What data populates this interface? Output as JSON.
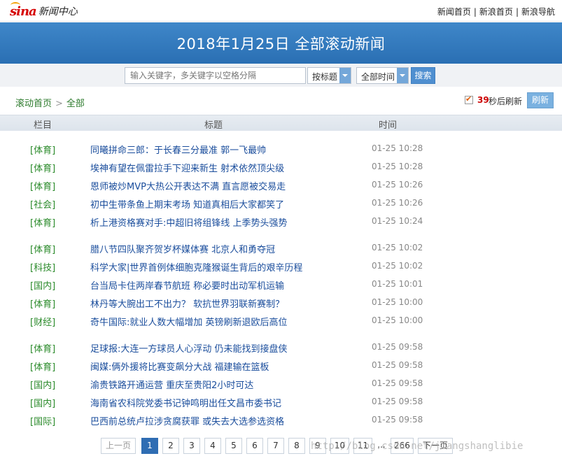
{
  "topbar": {
    "logo_mark": "sina",
    "logo_text": "新闻中心",
    "links": [
      "新闻首页",
      "新浪首页",
      "新浪导航"
    ],
    "separator": "|"
  },
  "banner": {
    "title": "2018年1月25日 全部滚动新闻"
  },
  "search": {
    "placeholder": "输入关键字，多关键字以空格分隔",
    "type_select": "按标题",
    "time_select": "全部时间",
    "button": "搜索"
  },
  "breadcrumb": {
    "home": "滚动首页",
    "sep": ">",
    "current": "全部"
  },
  "refresh": {
    "checked": true,
    "seconds": "39",
    "text": "秒后刷新",
    "button": "刷新"
  },
  "columns": {
    "category": "栏目",
    "title": "标题",
    "time": "时间"
  },
  "news_groups": [
    [
      {
        "cat": "[体育]",
        "title": "同曦拼命三郎：于长春三分最准 郭一飞最帅",
        "time": "01-25 10:28"
      },
      {
        "cat": "[体育]",
        "title": "埃神有望在佩雷拉手下迎来新生 射术依然顶尖级",
        "time": "01-25 10:28"
      },
      {
        "cat": "[体育]",
        "title": "恩师被炒MVP大热公开表达不满 直言愿被交易走",
        "time": "01-25 10:26"
      },
      {
        "cat": "[社会]",
        "title": "初中生带条鱼上期末考场 知道真相后大家都笑了",
        "time": "01-25 10:26"
      },
      {
        "cat": "[体育]",
        "title": "析上港资格赛对手:中超旧将组锋线 上季势头强势",
        "time": "01-25 10:24"
      }
    ],
    [
      {
        "cat": "[体育]",
        "title": "腊八节四队聚齐贺岁杯媒体赛 北京人和勇夺冠",
        "time": "01-25 10:02"
      },
      {
        "cat": "[科技]",
        "title": "科学大家|世界首例体细胞克隆猴诞生背后的艰辛历程",
        "time": "01-25 10:02"
      },
      {
        "cat": "[国内]",
        "title": "台当局卡住两岸春节航班 称必要时出动军机运输",
        "time": "01-25 10:01"
      },
      {
        "cat": "[体育]",
        "title": "林丹等大腕出工不出力？ 软抗世界羽联新赛制？",
        "time": "01-25 10:00"
      },
      {
        "cat": "[财经]",
        "title": "奇牛国际:就业人数大幅增加 英镑刷新退欧后高位",
        "time": "01-25 10:00"
      }
    ],
    [
      {
        "cat": "[体育]",
        "title": "足球报:大连一方球员人心浮动 仍未能找到接盘侠",
        "time": "01-25 09:58"
      },
      {
        "cat": "[体育]",
        "title": "闽媒:俩外援将比赛变飙分大战 福建输在篮板",
        "time": "01-25 09:58"
      },
      {
        "cat": "[国内]",
        "title": "渝贵铁路开通运营 重庆至贵阳2小时可达",
        "time": "01-25 09:58"
      },
      {
        "cat": "[国内]",
        "title": "海南省农科院党委书记钟鸣明出任文昌市委书记",
        "time": "01-25 09:58"
      },
      {
        "cat": "[国际]",
        "title": "巴西前总统卢拉涉贪腐获罪 或失去大选参选资格",
        "time": "01-25 09:58"
      }
    ]
  ],
  "pagination": {
    "prev": "上一页",
    "pages": [
      "1",
      "2",
      "3",
      "4",
      "5",
      "6",
      "7",
      "8",
      "9",
      "10",
      "11"
    ],
    "current": "1",
    "ellipsis": "...",
    "last": "266",
    "next": "下一页"
  },
  "watermark": "http://blog.csdn.net/jiangshanglibie",
  "colors": {
    "banner": "#2f78bf",
    "category_green": "#2a8a2a",
    "title_blue": "#1a4d9c",
    "refresh_count_red": "#cc0000"
  }
}
